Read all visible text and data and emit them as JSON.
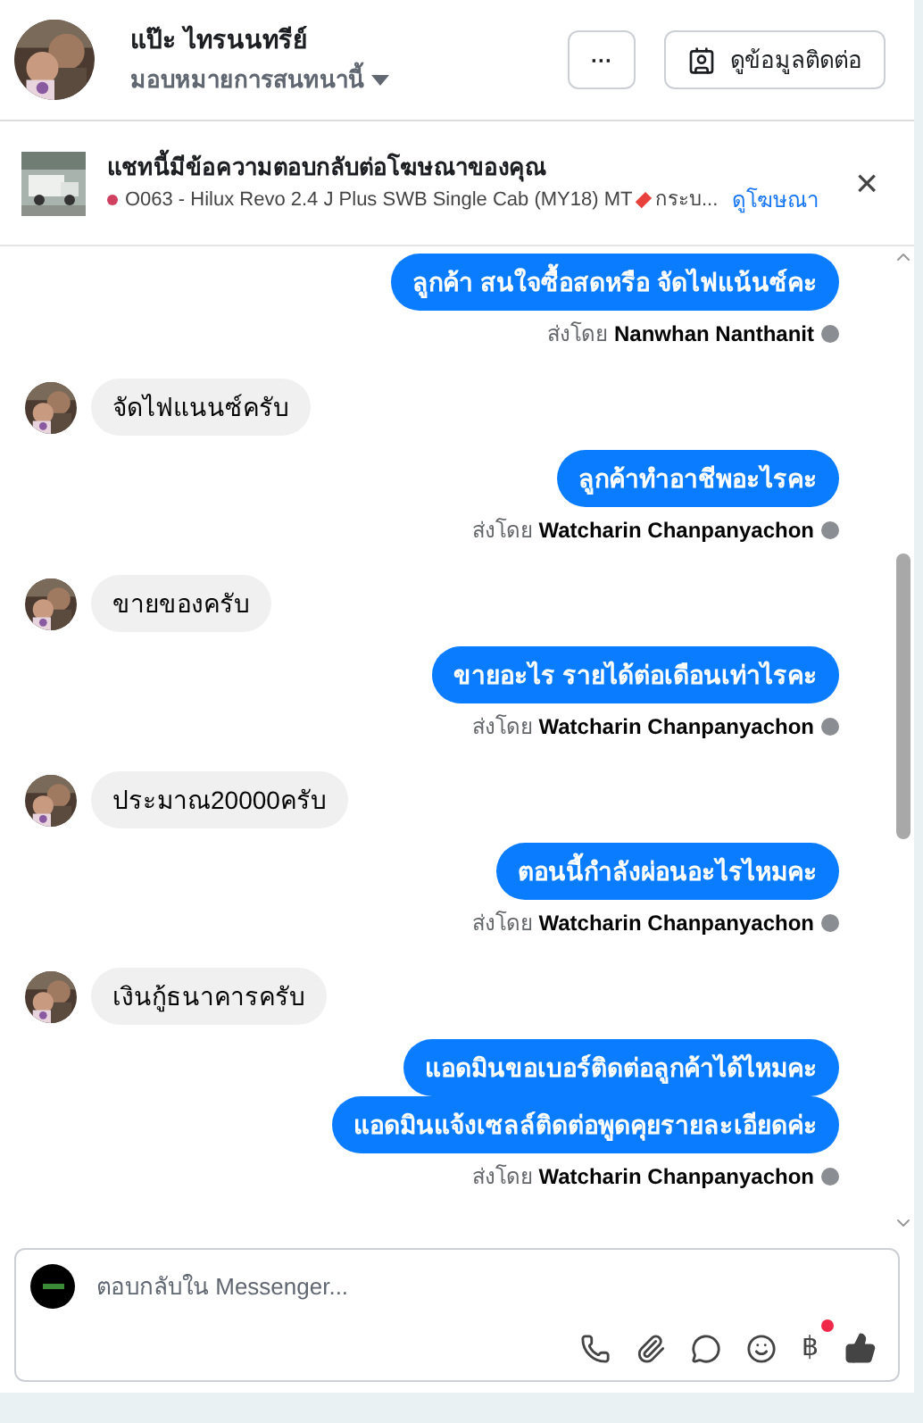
{
  "header": {
    "name": "แป๊ะ ไทรนนทรีย์",
    "assign": "มอบหมายการสนทนานี้",
    "more": "···",
    "contact_button": "ดูข้อมูลติดต่อ"
  },
  "ad_banner": {
    "title": "แชทนี้มีข้อความตอบกลับต่อโฆษณาของคุณ",
    "ad_text": "O063 - Hilux Revo 2.4 J Plus SWB Single Cab (MY18) MT",
    "ad_more": "กระบ...",
    "link": "ดูโฆษณา",
    "close": "×"
  },
  "messages": [
    {
      "kind": "outgoing",
      "text": "ลูกค้า สนใจซื้อสดหรือ จัดไฟแน้นซ์คะ"
    },
    {
      "kind": "sent_by",
      "label": "ส่งโดย",
      "name": "Nanwhan Nanthanit"
    },
    {
      "kind": "incoming",
      "text": "จัดไฟแนนซ์ครับ"
    },
    {
      "kind": "outgoing",
      "text": "ลูกค้าทำอาชีพอะไรคะ"
    },
    {
      "kind": "sent_by",
      "label": "ส่งโดย",
      "name": "Watcharin Chanpanyachon"
    },
    {
      "kind": "incoming",
      "text": "ขายของครับ"
    },
    {
      "kind": "outgoing",
      "text": "ขายอะไร รายได้ต่อเดือนเท่าไรคะ"
    },
    {
      "kind": "sent_by",
      "label": "ส่งโดย",
      "name": "Watcharin Chanpanyachon"
    },
    {
      "kind": "incoming",
      "text": "ประมาณ20000ครับ"
    },
    {
      "kind": "outgoing",
      "text": "ตอนนี้กำลังผ่อนอะไรไหมคะ"
    },
    {
      "kind": "sent_by",
      "label": "ส่งโดย",
      "name": "Watcharin Chanpanyachon"
    },
    {
      "kind": "incoming",
      "text": "เงินกู้ธนาคารครับ"
    },
    {
      "kind": "outgoing",
      "text": "แอดมินขอเบอร์ติดต่อลูกค้าได้ไหมคะ"
    },
    {
      "kind": "outgoing",
      "text": "แอดมินแจ้งเซลล์ติดต่อพูดคุยรายละเอียดค่ะ"
    },
    {
      "kind": "sent_by",
      "label": "ส่งโดย",
      "name": "Watcharin Chanpanyachon"
    }
  ],
  "composer": {
    "placeholder": "ตอบกลับใน Messenger...",
    "baht": "฿",
    "baht_notification": true
  }
}
